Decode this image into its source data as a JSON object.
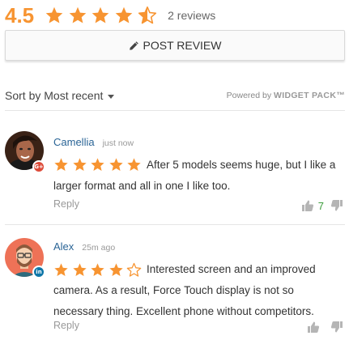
{
  "summary": {
    "average": "4.5",
    "rating": 4.5,
    "reviews_count": "2 reviews"
  },
  "post_review_label": "POST REVIEW",
  "sort": {
    "label": "Sort by Most recent"
  },
  "powered": {
    "prefix": "Powered by",
    "brand": "WIDGET PACK™"
  },
  "colors": {
    "star": "#f79431",
    "like": "#3c9c3c"
  },
  "reviews": [
    {
      "name": "Camellia",
      "time": "just now",
      "rating": 5,
      "source_icon": "google-plus-icon",
      "source_badge": "G+",
      "text": "After 5 models seems huge, but I like a larger format and all in one I like too.",
      "reply_label": "Reply",
      "likes": "7"
    },
    {
      "name": "Alex",
      "time": "25m ago",
      "rating": 4,
      "source_icon": "linkedin-icon",
      "source_badge": "in",
      "text": "Interested screen and an improved camera. As a result, Force Touch display is not so necessary thing. Excellent phone without competitors.",
      "reply_label": "Reply",
      "likes": ""
    }
  ]
}
